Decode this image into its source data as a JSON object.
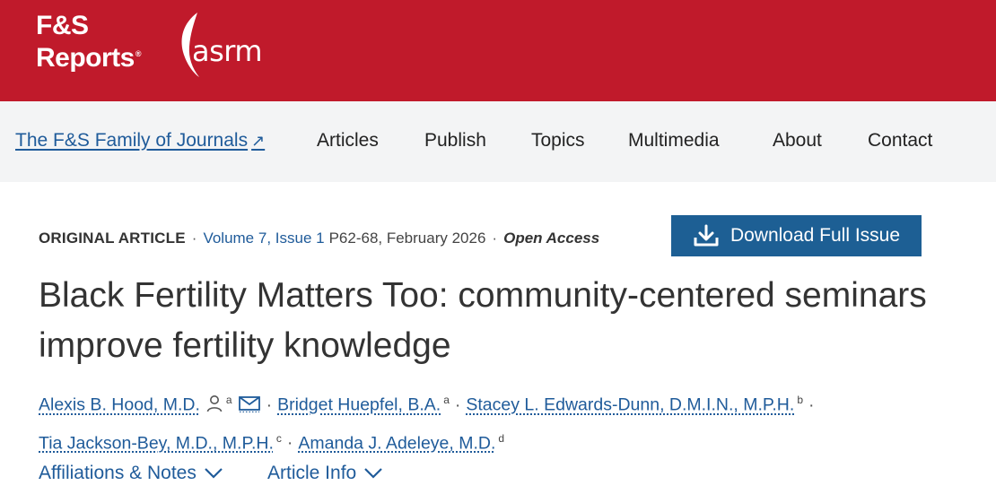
{
  "brand": {
    "fs_line1": "F&S",
    "fs_line2": "Reports",
    "fs_reg": "®",
    "asrm": "asrm",
    "bar_color": "#c01a2b"
  },
  "nav": {
    "family_link": "The F&S Family of Journals",
    "family_icon": "external-link-arrow-icon",
    "items": [
      "Articles",
      "Publish",
      "Topics",
      "Multimedia",
      "About",
      "Contact"
    ]
  },
  "meta": {
    "article_type": "ORIGINAL ARTICLE",
    "volume_issue": "Volume 7, Issue 1",
    "pages_date": "P62-68, February 2026",
    "access": "Open Access",
    "separator": "·"
  },
  "download": {
    "label": "Download Full Issue",
    "icon": "download-icon",
    "color": "#1d5f94"
  },
  "title": "Black Fertility Matters Too: community-centered seminars improve fertility knowledge",
  "authors": [
    {
      "name": "Alexis B. Hood, M.D.",
      "aff": "a"
    },
    {
      "name": "Bridget Huepfel, B.A.",
      "aff": "a"
    },
    {
      "name": "Stacey L. Edwards-Dunn, D.M.I.N., M.P.H.",
      "aff": "b"
    },
    {
      "name": "Tia Jackson-Bey, M.D., M.P.H.",
      "aff": "c"
    },
    {
      "name": "Amanda J. Adeleye, M.D.",
      "aff": "d"
    }
  ],
  "toggles": {
    "affiliations": "Affiliations & Notes",
    "article_info": "Article Info"
  },
  "colors": {
    "link": "#1f5b9a",
    "nav_bg": "#f3f4f5"
  }
}
